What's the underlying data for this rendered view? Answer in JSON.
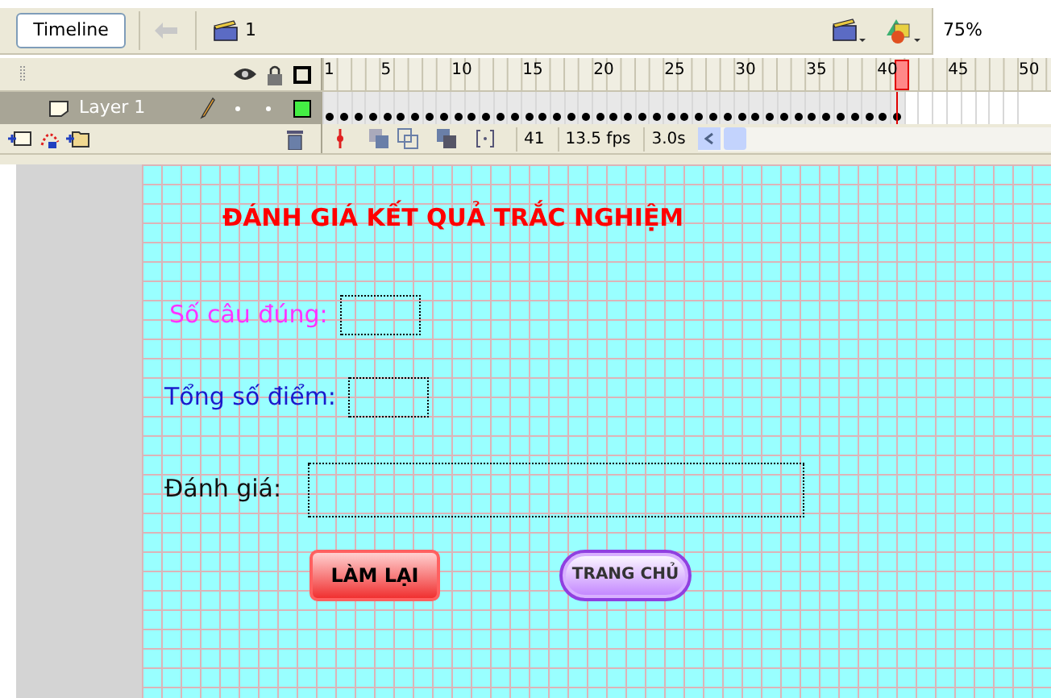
{
  "toolbar": {
    "timeline_button": "Timeline",
    "scene": "1",
    "zoom": "75%"
  },
  "timeline": {
    "ruler": [
      "1",
      "5",
      "10",
      "15",
      "20",
      "25",
      "30",
      "35",
      "40",
      "45",
      "50"
    ],
    "layers": [
      {
        "name": "Layer 1",
        "selected": true
      }
    ],
    "frames": {
      "level": 0.82
    },
    "status": {
      "frame": "41",
      "fps": "13.5 fps",
      "time": "3.0s"
    }
  },
  "stage": {
    "title": "ĐÁNH GIÁ KẾT QUẢ TRẮC NGHIỆM",
    "fields": [
      {
        "label": "Số câu  đúng:",
        "kind": "short",
        "color": "#ff33ff"
      },
      {
        "label": "Tổng số điểm:",
        "kind": "short",
        "color": "#1a1acc"
      },
      {
        "label": "Đánh giá:",
        "kind": "long",
        "color": "#111111"
      }
    ],
    "buttons": [
      {
        "label": "LÀM LẠI",
        "kind": "red"
      },
      {
        "label": "TRANG CHỦ",
        "kind": "pill"
      }
    ]
  }
}
